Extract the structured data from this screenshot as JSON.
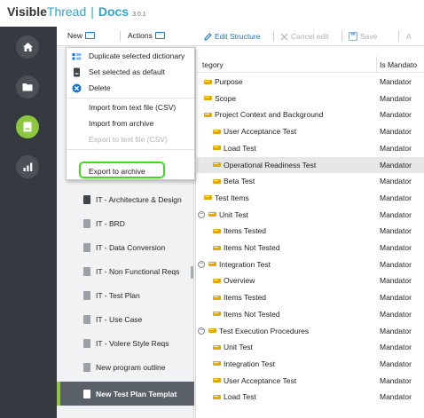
{
  "brand": {
    "visible": "Visible",
    "thread": "Thread",
    "separator": "|",
    "docs": "Docs",
    "version": "3.0.1"
  },
  "toolbar": {
    "new_label": "New",
    "actions_label": "Actions",
    "dots": "···"
  },
  "actions_menu": {
    "items": [
      {
        "label": "Duplicate selected dictionary",
        "icon": "duplicate-icon",
        "disabled": false
      },
      {
        "label": "Set selected as default",
        "icon": "book-icon",
        "disabled": false
      },
      {
        "label": "Delete",
        "icon": "delete-circle-icon",
        "disabled": false
      },
      {
        "label": "Import from text file (CSV)",
        "icon": "",
        "disabled": false
      },
      {
        "label": "Import from archive",
        "icon": "",
        "disabled": false
      },
      {
        "label": "Export to text file (CSV)",
        "icon": "",
        "disabled": true
      },
      {
        "label": "Export to archive",
        "icon": "",
        "disabled": false
      }
    ],
    "highlight_color": "#3ddc1a"
  },
  "dictionaries": [
    {
      "label": "IT - Architecture & Design",
      "selected": false
    },
    {
      "label": "IT - BRD",
      "selected": false
    },
    {
      "label": "IT - Data Conversion",
      "selected": false
    },
    {
      "label": "IT - Non Functional Reqs",
      "selected": false
    },
    {
      "label": "IT - Test Plan",
      "selected": false
    },
    {
      "label": "IT - Use Case",
      "selected": false
    },
    {
      "label": "IT - Volere Style Reqs",
      "selected": false
    },
    {
      "label": "New program outline",
      "selected": false
    },
    {
      "label": "New Test Plan Templat",
      "selected": true
    }
  ],
  "grid_toolbar": {
    "edit_structure": "Edit Structure",
    "cancel_edit": "Cancel edit",
    "save": "Save",
    "cut_label": "A"
  },
  "grid": {
    "col_category": "tegory",
    "col_mandatory": "Is Mandato",
    "rows": [
      {
        "label": "Purpose",
        "level": 1,
        "toggle": "",
        "mandatory": "Mandator",
        "selected": false
      },
      {
        "label": "Scope",
        "level": 1,
        "toggle": "",
        "mandatory": "Mandator",
        "selected": false
      },
      {
        "label": "Project Context and Background",
        "level": 1,
        "toggle": "",
        "mandatory": "Mandator",
        "selected": false
      },
      {
        "label": "User Acceptance Test",
        "level": 2,
        "toggle": "",
        "mandatory": "Mandator",
        "selected": false
      },
      {
        "label": "Load Test",
        "level": 2,
        "toggle": "",
        "mandatory": "Mandator",
        "selected": false
      },
      {
        "label": "Operational Readiness Test",
        "level": 2,
        "toggle": "",
        "mandatory": "Mandator",
        "selected": true
      },
      {
        "label": "Beta Test",
        "level": 2,
        "toggle": "",
        "mandatory": "Mandator",
        "selected": false
      },
      {
        "label": "Test Items",
        "level": 1,
        "toggle": "",
        "mandatory": "Mandator",
        "selected": false
      },
      {
        "label": "Unit Test",
        "level": 0,
        "toggle": "−",
        "mandatory": "Mandator",
        "selected": false
      },
      {
        "label": "Items Tested",
        "level": 2,
        "toggle": "",
        "mandatory": "Mandator",
        "selected": false
      },
      {
        "label": "Items Not Tested",
        "level": 2,
        "toggle": "",
        "mandatory": "Mandator",
        "selected": false
      },
      {
        "label": "Integration Test",
        "level": 0,
        "toggle": "−",
        "mandatory": "Mandator",
        "selected": false
      },
      {
        "label": "Overview",
        "level": 2,
        "toggle": "",
        "mandatory": "Mandator",
        "selected": false
      },
      {
        "label": "Items Tested",
        "level": 2,
        "toggle": "",
        "mandatory": "Mandator",
        "selected": false
      },
      {
        "label": "Items Not Tested",
        "level": 2,
        "toggle": "",
        "mandatory": "Mandator",
        "selected": false
      },
      {
        "label": "Test Execution Procedures",
        "level": 0,
        "toggle": "−",
        "mandatory": "Mandator",
        "selected": false
      },
      {
        "label": "Unit Test",
        "level": 2,
        "toggle": "",
        "mandatory": "Mandator",
        "selected": false
      },
      {
        "label": "Integration Test",
        "level": 2,
        "toggle": "",
        "mandatory": "Mandator",
        "selected": false
      },
      {
        "label": "User Acceptance Test",
        "level": 2,
        "toggle": "",
        "mandatory": "Mandator",
        "selected": false
      },
      {
        "label": "Load Test",
        "level": 2,
        "toggle": "",
        "mandatory": "Mandator",
        "selected": false
      }
    ]
  },
  "colors": {
    "brand_blue": "#2ba7c9",
    "rail_dark": "#343a40",
    "active_green": "#8dc63f",
    "link_blue": "#1a73c6",
    "tag_gold": "#e5a800"
  }
}
